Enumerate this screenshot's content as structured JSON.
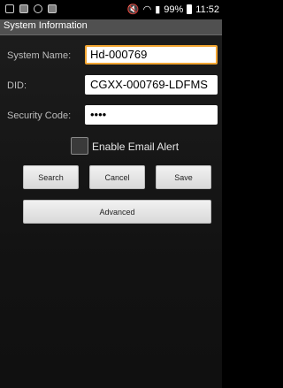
{
  "status_bar": {
    "battery": "99%",
    "time": "11:52",
    "signal_text": "⚡◆▮"
  },
  "window": {
    "title": "System Information"
  },
  "form": {
    "system_name_label": "System Name:",
    "system_name_value": "Hd-000769",
    "did_label": "DID:",
    "did_value": "CGXX-000769-LDFMS",
    "security_label": "Security Code:",
    "security_value": "••••",
    "email_alert_label": "Enable Email Alert",
    "email_alert_checked": false
  },
  "buttons": {
    "search": "Search",
    "cancel": "Cancel",
    "save": "Save",
    "advanced": "Advanced"
  },
  "colors": {
    "focus_border": "#f2a531",
    "title_bar": "#505050"
  }
}
